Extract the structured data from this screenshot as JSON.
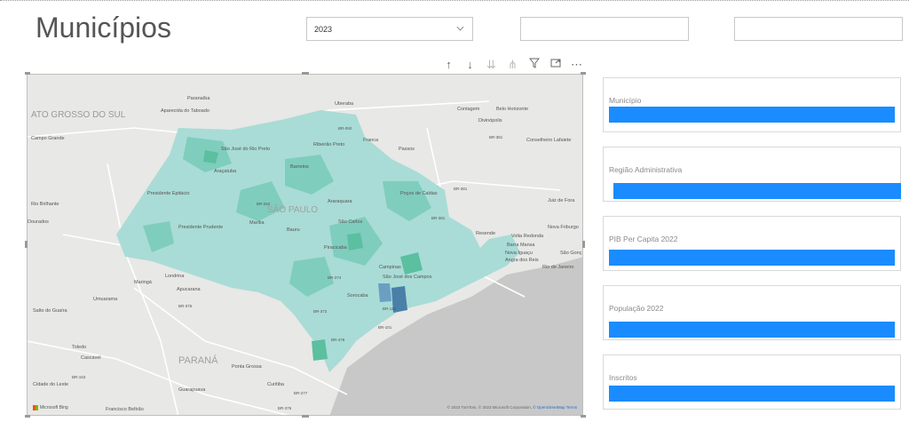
{
  "page": {
    "title": "Municípios"
  },
  "filters": {
    "year_value": "2023",
    "filter2_value": "",
    "filter3_value": ""
  },
  "toolbar": {
    "icons": [
      "arrow-up-icon",
      "arrow-down-icon",
      "double-arrow-down-icon",
      "expand-hierarchy-icon",
      "filter-icon",
      "focus-mode-icon",
      "more-options-icon"
    ],
    "more_glyph": "⋯"
  },
  "map": {
    "labels": {
      "mato_grosso_do_sul": "ATO GROSSO DO SUL",
      "campo_grande": "Campo Grande",
      "parana": "PARANÁ",
      "sao_paulo": "SÃO PAULO",
      "uberaba": "Uberaba",
      "contagem": "Contagem",
      "belo_horizonte": "Belo Horizonte",
      "divinopolis": "Divinópolis",
      "franca": "Franca",
      "passos": "Passos",
      "conselheiro_lafaiete": "Conselheiro Lafaiete",
      "ribeirao_preto": "Ribeirão Preto",
      "pocos_de_caldas": "Poços de Caldas",
      "juiz_de_fora": "Juiz de Fora",
      "nova_friburgo": "Nova Friburgo",
      "volta_redonda": "Volta Redonda",
      "barra_mansa": "Barra Mansa",
      "nova_iguacu": "Nova Iguaçu",
      "sao_goncalo": "São Gonç",
      "angra_dos_reis": "Angra dos Reis",
      "rio_de_janeiro": "Rio de Janeiro",
      "resende": "Resende",
      "sao_jose_rio_preto": "São José do Rio Preto",
      "aracatuba": "Araçatuba",
      "presidente_prudente": "Presidente Prudente",
      "presidente_epitacio": "Presidente Epitácio",
      "barretos": "Barretos",
      "marilia": "Marília",
      "bauru": "Bauru",
      "araraquara": "Araraquara",
      "sao_carlos": "São Carlos",
      "piracicaba": "Piracicaba",
      "campinas": "Campinas",
      "sorocaba": "Sorocaba",
      "sao_jose_campos": "São José dos Campos",
      "londrina": "Londrina",
      "maringa": "Maringá",
      "apucarana": "Apucarana",
      "umuarama": "Umuarama",
      "toledo": "Toledo",
      "cascavel": "Cascavel",
      "guarapuava": "Guarapuava",
      "ponta_grossa": "Ponta Grossa",
      "curitiba": "Curitiba",
      "paranaiba": "Paranaíba",
      "aparecida_taboado": "Aparecida do Taboado",
      "rio_brilhante": "Rio Brilhante",
      "dourados": "Dourados",
      "salto_guaira": "Salto do Guaíra",
      "cidade_leste": "Cidade do Leste",
      "francisco_beltrao": "Francisco Beltrão",
      "br050": "BR-050",
      "br381a": "BR-381",
      "br381b": "BR-381",
      "br381c": "BR-381",
      "br262": "BR-262",
      "br374": "BR-374",
      "br373": "BR-373",
      "br116": "BR-116",
      "br101": "BR-101",
      "br376": "BR-376",
      "br163": "BR-163",
      "br277": "BR-277",
      "br376b": "BR-376",
      "br478": "BR-478"
    },
    "attribution_text": "© 2023 TomTom, © 2023 Microsoft Corporation, ",
    "attribution_link": "© OpenStreetMap  Terms",
    "logo_text": "Microsoft Bing"
  },
  "cards": [
    {
      "label": "Município"
    },
    {
      "label": "Região Administrativa"
    },
    {
      "label": "PIB Per Capita 2022"
    },
    {
      "label": "População 2022"
    },
    {
      "label": "Inscritos"
    }
  ],
  "colors": {
    "accent_bar": "#1a8cff",
    "region_light": "#a9dcd6",
    "region_mid": "#7fcdbd",
    "region_dark": "#5bbfa0",
    "region_highlight": "#4a7fa8",
    "ocean": "#c5c5c5",
    "land": "#e8e8e6"
  }
}
